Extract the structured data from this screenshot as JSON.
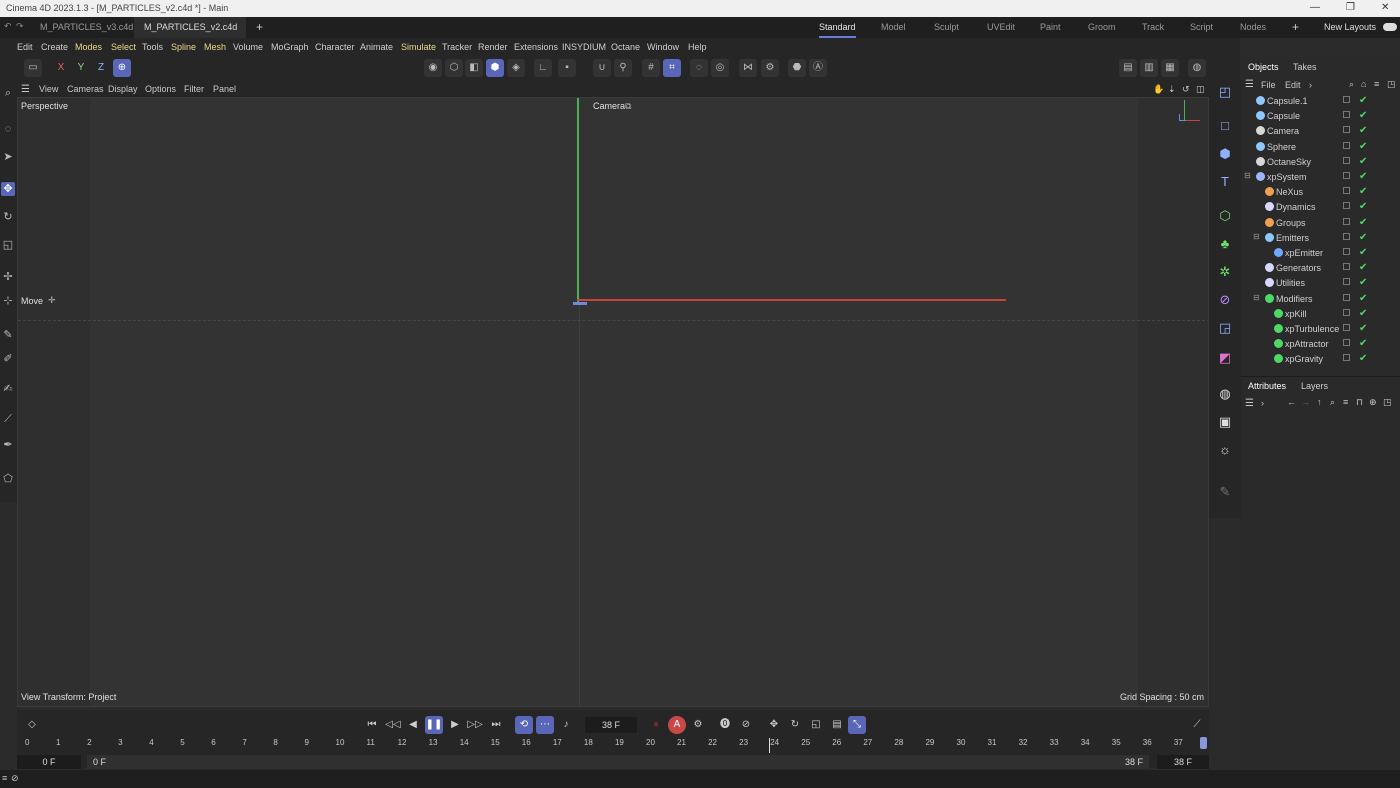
{
  "window": {
    "title": "Cinema 4D 2023.1.3 - [M_PARTICLES_v2.c4d *] - Main"
  },
  "doc_tabs": [
    {
      "label": "M_PARTICLES_v3.c4d",
      "active": false
    },
    {
      "label": "M_PARTICLES_v2.c4d *",
      "active": true
    }
  ],
  "layouts": {
    "items": [
      "Standard",
      "Model",
      "Sculpt",
      "UVEdit",
      "Paint",
      "Groom",
      "Track",
      "Script",
      "Nodes"
    ],
    "active": "Standard",
    "new_layouts_label": "New Layouts"
  },
  "menu": [
    "Edit",
    "Create",
    "Modes",
    "Select",
    "Tools",
    "Spline",
    "Mesh",
    "Volume",
    "MoGraph",
    "Character",
    "Animate",
    "Simulate",
    "Tracker",
    "Render",
    "Extensions",
    "INSYDIUM",
    "Octane",
    "Window",
    "Help"
  ],
  "toolbar": {
    "axes": [
      "X",
      "Y",
      "Z"
    ]
  },
  "viewport": {
    "menu": [
      "View",
      "Cameras",
      "Display",
      "Options",
      "Filter",
      "Panel"
    ],
    "name": "Perspective",
    "camera_label": "Camera",
    "move_label": "Move",
    "view_transform": "View Transform: Project",
    "grid_spacing": "Grid Spacing : 50 cm"
  },
  "objects_panel": {
    "tabs": [
      "Objects",
      "Takes"
    ],
    "menu": [
      "File",
      "Edit"
    ],
    "items": [
      {
        "name": "Capsule.1",
        "indent": 0,
        "icon_color": "#8ec8ff"
      },
      {
        "name": "Capsule",
        "indent": 0,
        "icon_color": "#8ec8ff"
      },
      {
        "name": "Camera",
        "indent": 0,
        "icon_color": "#d8d8d8"
      },
      {
        "name": "Sphere",
        "indent": 0,
        "icon_color": "#8ec8ff"
      },
      {
        "name": "OctaneSky",
        "indent": 0,
        "icon_color": "#d8d8d8"
      },
      {
        "name": "xpSystem",
        "indent": 0,
        "icon_color": "#9fb6ff"
      },
      {
        "name": "NeXus",
        "indent": 1,
        "icon_color": "#f0a050"
      },
      {
        "name": "Dynamics",
        "indent": 1,
        "icon_color": "#d8d8ff"
      },
      {
        "name": "Groups",
        "indent": 1,
        "icon_color": "#f0a050"
      },
      {
        "name": "Emitters",
        "indent": 1,
        "icon_color": "#8ec8ff"
      },
      {
        "name": "xpEmitter",
        "indent": 2,
        "icon_color": "#6fa8ff"
      },
      {
        "name": "Generators",
        "indent": 1,
        "icon_color": "#d8d8ff"
      },
      {
        "name": "Utilities",
        "indent": 1,
        "icon_color": "#d8d8ff"
      },
      {
        "name": "Modifiers",
        "indent": 1,
        "icon_color": "#4cd964"
      },
      {
        "name": "xpKill",
        "indent": 2,
        "icon_color": "#4cd964"
      },
      {
        "name": "xpTurbulence",
        "indent": 2,
        "icon_color": "#4cd964"
      },
      {
        "name": "xpAttractor",
        "indent": 2,
        "icon_color": "#4cd964"
      },
      {
        "name": "xpGravity",
        "indent": 2,
        "icon_color": "#4cd964"
      }
    ]
  },
  "attributes_panel": {
    "tabs": [
      "Attributes",
      "Layers"
    ]
  },
  "timeline": {
    "current_frame": "38 F",
    "start_field": "0 F",
    "start_field2": "0 F",
    "end_field": "38 F",
    "end_field2": "38 F",
    "ticks": [
      "0",
      "1",
      "2",
      "3",
      "4",
      "5",
      "6",
      "7",
      "8",
      "9",
      "10",
      "11",
      "12",
      "13",
      "14",
      "15",
      "16",
      "17",
      "18",
      "19",
      "20",
      "21",
      "22",
      "23",
      "24",
      "25",
      "26",
      "27",
      "28",
      "29",
      "30",
      "31",
      "32",
      "33",
      "34",
      "35",
      "36",
      "37"
    ]
  },
  "colors": {
    "accent": "#5a66b8",
    "x_axis": "#d9443a",
    "y_axis": "#4caf50",
    "check": "#4cd964"
  }
}
